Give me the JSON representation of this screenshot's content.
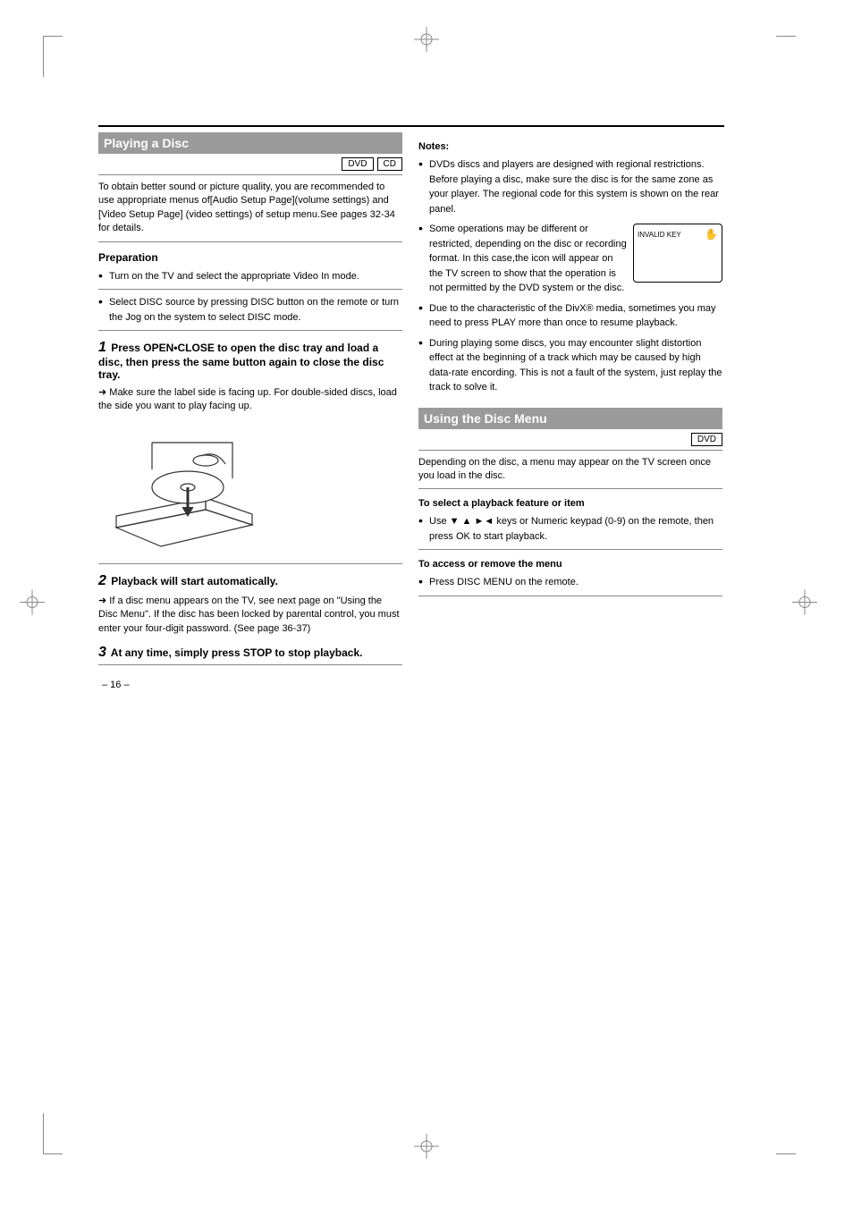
{
  "left": {
    "header": "Playing a Disc",
    "tags": [
      "DVD",
      "CD"
    ],
    "intro": "To obtain better sound or picture quality, you are recommended to use appropriate menus of[Audio Setup Page](volume settings) and [Video Setup Page] (video settings) of setup menu.See pages 32-34 for details.",
    "prep_title": "Preparation",
    "prep_b1": "Turn on the TV and select the appropriate Video In mode.",
    "prep_b2": "Select DISC source by pressing DISC button on the remote or turn the Jog on the system to select DISC mode.",
    "step1_title": "Press OPEN•CLOSE to open the disc tray and load a disc, then press the same button again to close the disc tray.",
    "step1_note": "Make sure the label side is facing up. For double-sided discs, load the side you want to play facing up.",
    "step2_title": "Playback will start automatically.",
    "step2_body": "If a disc menu appears on the TV, see next page on \"Using the Disc Menu\".\nIf the disc has been locked by parental control, you must enter your four-digit password. (See page 36-37)",
    "step3_title": "At any time, simply press STOP to stop playback."
  },
  "right": {
    "notes_title": "Notes:",
    "n1": "DVDs discs and players are designed with regional restrictions. Before playing a disc, make sure the disc is for the same zone as your player. The regional code for this system is shown on the rear panel.",
    "n2": "Some operations may be different or restricted, depending on the disc or recording format. In this case,the icon          will appear on the TV screen to show that the operation is not permitted by the DVD system or the disc.",
    "screen_corner": "✋",
    "screen_line": "INVALID KEY",
    "n3": "Due to the characteristic of the DivX® media, sometimes you may need to press PLAY more than once to resume playback.",
    "n4": "During playing some discs, you may encounter slight distortion effect at the beginning of a track which may be caused by high data-rate encording. This is not a fault of the system, just replay the track to solve it.",
    "header2": "Using the Disc Menu",
    "tag2": "DVD",
    "intro2": "Depending on the disc, a menu may appear on the TV screen once you load in the disc.",
    "sel_title": "To select a playback feature or item",
    "sel_b1": "Use  ▼ ▲ ►◄  keys or Numeric keypad (0-9) on the remote, then press OK to start playback.",
    "acc_title": "To access or remove the menu",
    "acc_b1": "Press DISC MENU on the remote."
  },
  "page_number": "– 16 –"
}
